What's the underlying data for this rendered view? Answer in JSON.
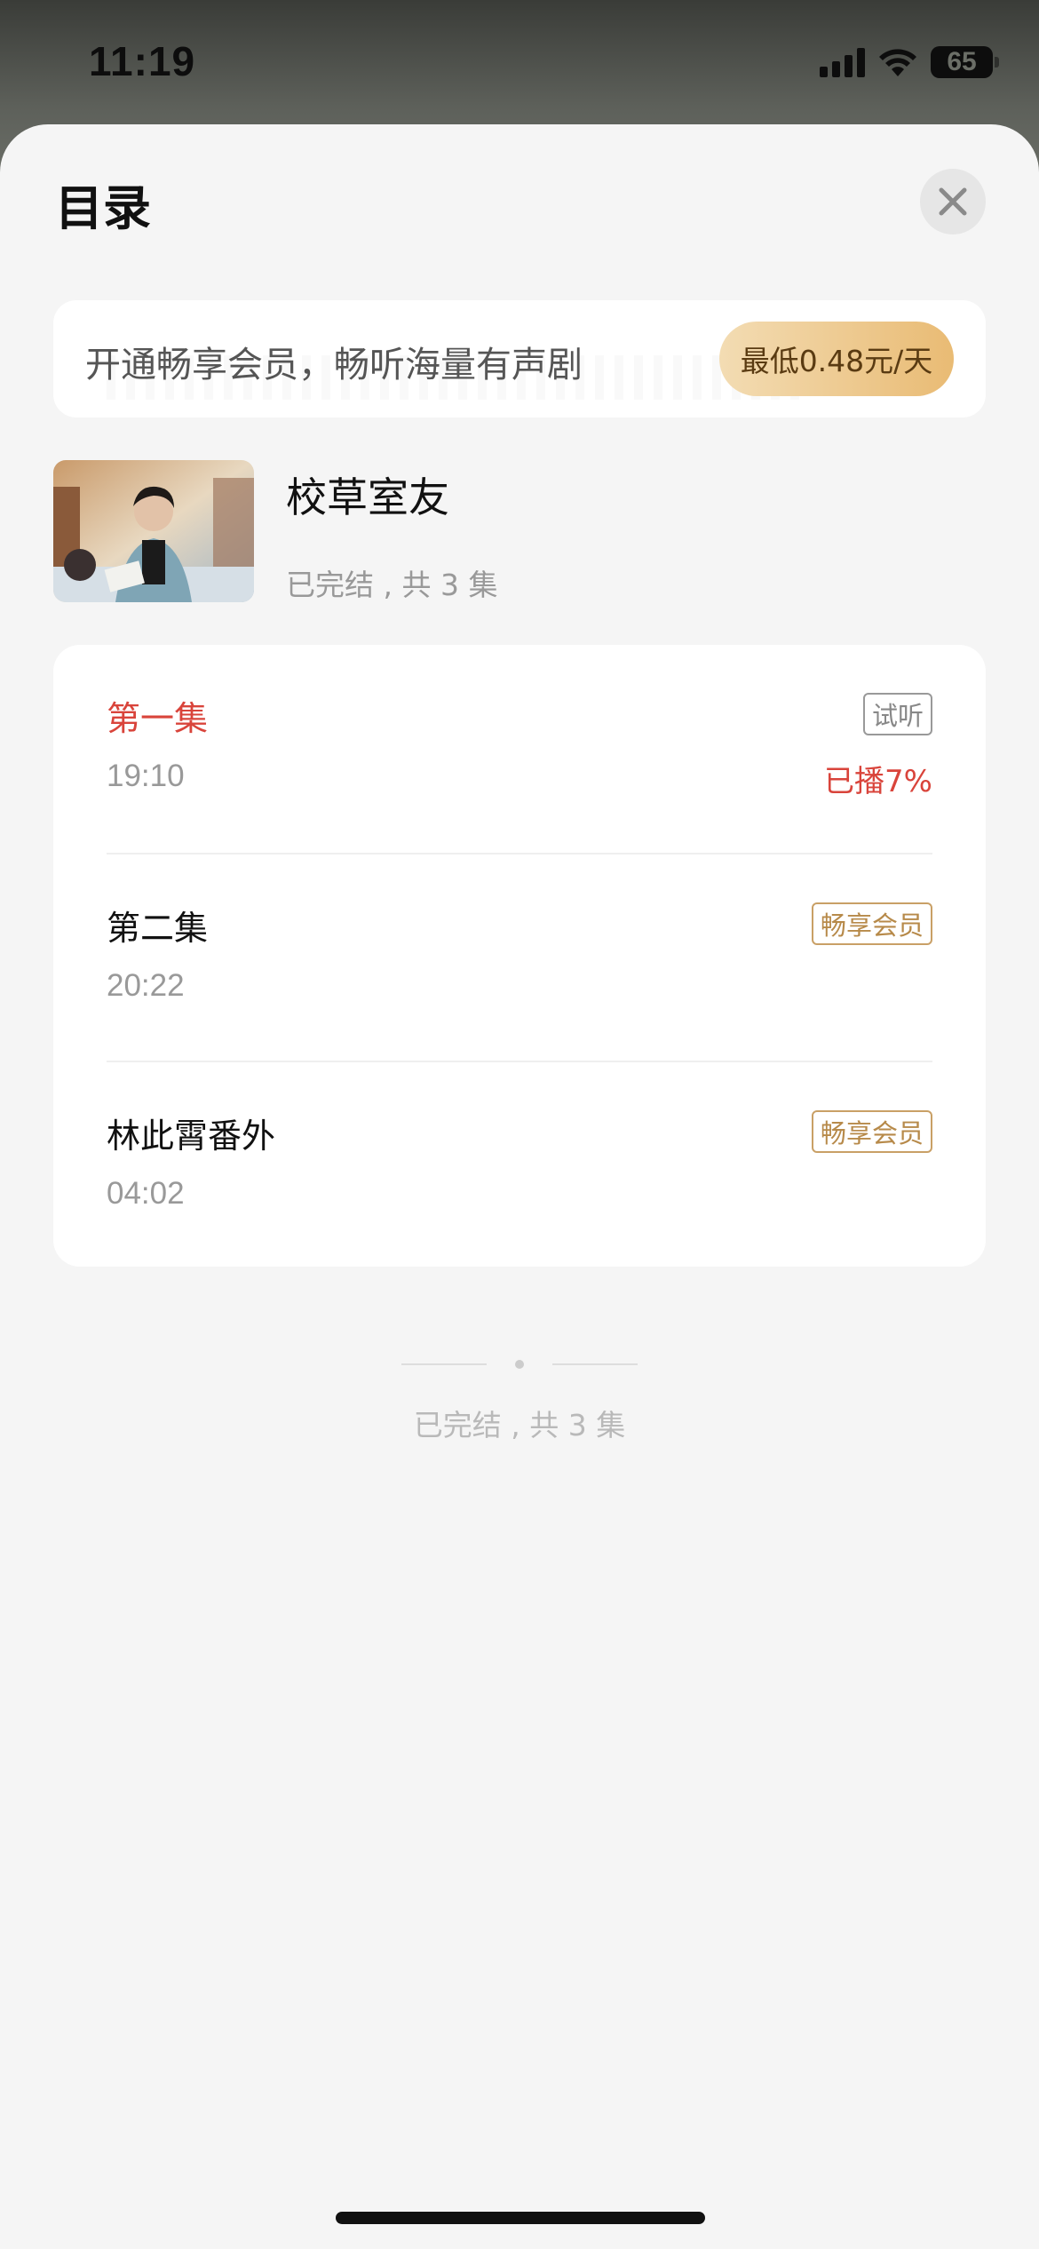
{
  "status_bar": {
    "time": "11:19",
    "battery": "65"
  },
  "sheet": {
    "title": "目录",
    "close_icon": "close-icon"
  },
  "vip_banner": {
    "text": "开通畅享会员，畅听海量有声剧",
    "button_label": "最低0.48元/天"
  },
  "album": {
    "title": "校草室友",
    "meta": "已完结 , 共 3 集"
  },
  "episodes": [
    {
      "title": "第一集",
      "duration": "19:10",
      "tag": "试听",
      "progress": "已播7%",
      "active": true
    },
    {
      "title": "第二集",
      "duration": "20:22",
      "tag": "畅享会员"
    },
    {
      "title": "林此霄番外",
      "duration": "04:02",
      "tag": "畅享会员"
    }
  ],
  "footer": {
    "end_text": "已完结 , 共 3 集"
  },
  "colors": {
    "accent_red": "#d9443b",
    "vip_gold": "#b78a4a",
    "vip_button_start": "#f3dcb3",
    "vip_button_end": "#e9bb74"
  }
}
